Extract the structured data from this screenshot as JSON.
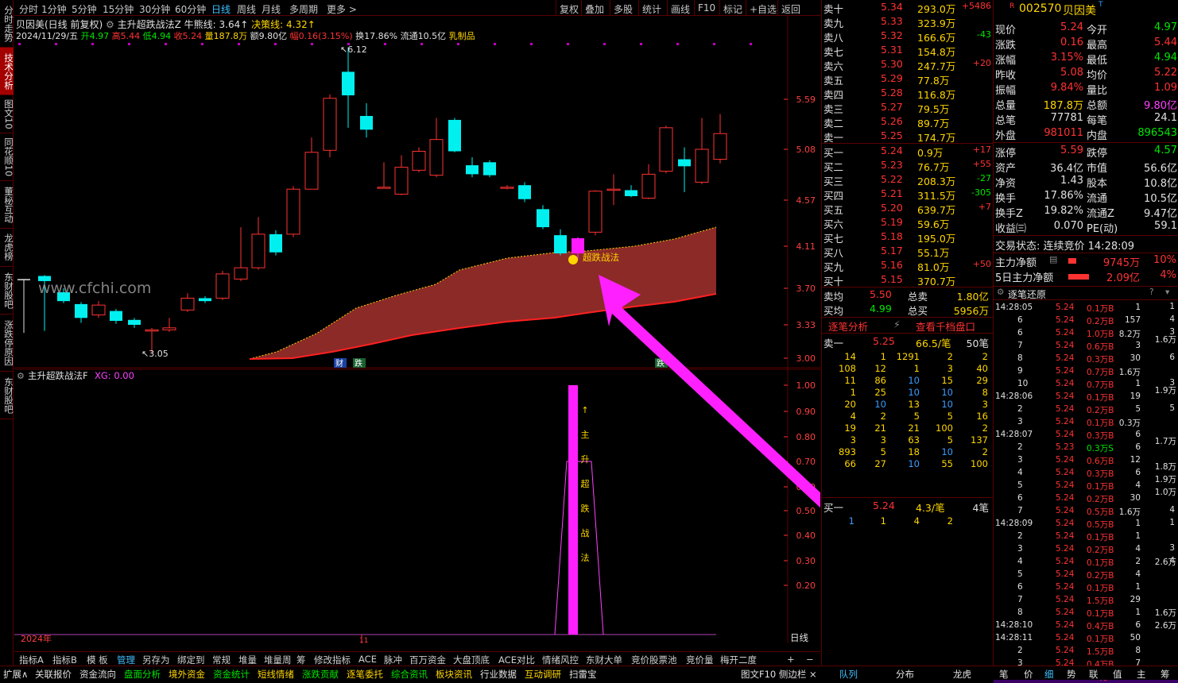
{
  "left_rail": [
    "分时走势",
    "技术分析",
    "图文10",
    "同花顺10",
    "董秘互动",
    "龙虎榜",
    "东财股吧",
    "涨跌停原因",
    "东财股吧"
  ],
  "top_menu": [
    "分时",
    "1分钟",
    "5分钟",
    "15分钟",
    "30分钟",
    "60分钟",
    "日线",
    "周线",
    "月线",
    "多周期",
    "更多 >"
  ],
  "top_right_menu": [
    "复权",
    "叠加",
    "多股",
    "统计",
    "画线",
    "F10",
    "标记",
    "+自选",
    "返回"
  ],
  "header": {
    "stock": "贝因美(日线 前复权)",
    "indicator": "主升超跌战法Z",
    "niuxiong_label": "牛熊线: 3.64↑",
    "juece_label": "决策线: 4.32↑",
    "date": "2024/11/29/五",
    "open": "开4.97",
    "high": "高5.44",
    "low": "低4.94",
    "close": "收5.24",
    "vol": "量187.8万",
    "amt": "额9.80亿",
    "pct": "幅0.16(3.15%)",
    "turn": "换17.86%",
    "float": "流通10.5亿",
    "sector": "乳制品"
  },
  "price_axis": [
    "5.59",
    "5.08",
    "4.57",
    "4.11",
    "3.70",
    "3.33",
    "3.00"
  ],
  "ind_axis": [
    "1.00",
    "0.90",
    "0.80",
    "0.70",
    "0.60",
    "0.50",
    "0.40",
    "0.30",
    "0.20"
  ],
  "annotations": {
    "high": "6.12",
    "low": "3.05",
    "signal": "超跌战法",
    "watermark": "www.cfchi.com",
    "badge1": "财",
    "badge2": "跌",
    "badge3": "跌",
    "year": "2024年",
    "month": "11",
    "period": "日线"
  },
  "sub_indicator": {
    "name": "主升超跌战法F",
    "xg": "XG: 0.00",
    "bar_text": [
      "↑",
      "主",
      "升",
      "超",
      "跌",
      "战",
      "法"
    ]
  },
  "bottom_tabs": [
    "指标A",
    "指标B",
    "模 板",
    "管理",
    "另存为",
    "绑定到",
    "常规",
    "堆量",
    "堆量周",
    "筹",
    "修改指标",
    "ACE",
    "脉冲",
    "百万资金",
    "大盘顶底",
    "ACE对比",
    "情绪风控",
    "东财大单",
    "竞价股票池",
    "竞价量",
    "梅开二度",
    "+",
    "−"
  ],
  "status_bar": [
    "扩展∧",
    "关联报价",
    "资金流向",
    "盘面分析",
    "境外资金",
    "资金统计",
    "短线情绪",
    "涨跌贡献",
    "逐笔委托",
    "综合资讯",
    "板块资讯",
    "行业数据",
    "互动调研",
    "扫雷宝",
    "图文F10 侧边栏 ×",
    "队列",
    "分布",
    "龙虎",
    "笔",
    "价",
    "细",
    "势",
    "联",
    "值",
    "主",
    "筹"
  ],
  "sell_orders": [
    [
      "卖十",
      "5.34",
      "293.0万",
      "+5486"
    ],
    [
      "卖九",
      "5.33",
      "323.9万",
      ""
    ],
    [
      "卖八",
      "5.32",
      "166.6万",
      "-43"
    ],
    [
      "卖七",
      "5.31",
      "154.8万",
      ""
    ],
    [
      "卖六",
      "5.30",
      "247.7万",
      "+20"
    ],
    [
      "卖五",
      "5.29",
      "77.8万",
      ""
    ],
    [
      "卖四",
      "5.28",
      "116.8万",
      ""
    ],
    [
      "卖三",
      "5.27",
      "79.5万",
      ""
    ],
    [
      "卖二",
      "5.26",
      "89.7万",
      ""
    ],
    [
      "卖一",
      "5.25",
      "174.7万",
      ""
    ]
  ],
  "buy_orders": [
    [
      "买一",
      "5.24",
      "0.9万",
      "+17"
    ],
    [
      "买二",
      "5.23",
      "76.7万",
      "+55"
    ],
    [
      "买三",
      "5.22",
      "208.3万",
      "-27"
    ],
    [
      "买四",
      "5.21",
      "311.5万",
      "-305"
    ],
    [
      "买五",
      "5.20",
      "639.7万",
      "+7"
    ],
    [
      "买六",
      "5.19",
      "59.6万",
      ""
    ],
    [
      "买七",
      "5.18",
      "195.0万",
      ""
    ],
    [
      "买八",
      "5.17",
      "55.1万",
      ""
    ],
    [
      "买九",
      "5.16",
      "81.0万",
      "+50"
    ],
    [
      "买十",
      "5.15",
      "370.7万",
      ""
    ]
  ],
  "ob_summary": {
    "sell_avg_l": "卖均",
    "sell_avg": "5.50",
    "sell_total_l": "总卖",
    "sell_total": "1.80亿",
    "buy_avg_l": "买均",
    "buy_avg": "4.99",
    "buy_total_l": "总买",
    "buy_total": "5956万"
  },
  "ob_links": [
    "逐笔分析",
    "查看千档盘口"
  ],
  "queue_sell": {
    "label": "卖一",
    "price": "5.25",
    "vol": "66.5/笔",
    "count": "50笔"
  },
  "queue_sell_rows": [
    [
      "14",
      "1",
      "1291",
      "2",
      "2"
    ],
    [
      "108",
      "12",
      "1",
      "3",
      "40"
    ],
    [
      "11",
      "86",
      "10",
      "15",
      "29"
    ],
    [
      "1",
      "25",
      "10",
      "10",
      "8"
    ],
    [
      "20",
      "10",
      "13",
      "10",
      "3"
    ],
    [
      "4",
      "2",
      "5",
      "5",
      "16"
    ],
    [
      "19",
      "21",
      "21",
      "100",
      "2"
    ],
    [
      "3",
      "3",
      "63",
      "5",
      "137"
    ],
    [
      "893",
      "5",
      "18",
      "10",
      "2"
    ],
    [
      "66",
      "27",
      "10",
      "55",
      "100"
    ]
  ],
  "queue_buy": {
    "label": "买一",
    "price": "5.24",
    "vol": "4.3/笔",
    "count": "4笔",
    "rows": [
      "1",
      "1",
      "4",
      "2"
    ]
  },
  "quote": {
    "code": "002570",
    "name": "贝因美",
    "rows": [
      [
        "现价",
        "5.24",
        "今开",
        "4.97"
      ],
      [
        "涨跌",
        "0.16",
        "最高",
        "5.44"
      ],
      [
        "涨幅",
        "3.15%",
        "最低",
        "4.94"
      ],
      [
        "昨收",
        "5.08",
        "均价",
        "5.22"
      ],
      [
        "振幅",
        "9.84%",
        "量比",
        "1.09"
      ],
      [
        "总量",
        "187.8万",
        "总额",
        "9.80亿"
      ],
      [
        "总笔",
        "77781",
        "每笔",
        "24.1"
      ],
      [
        "外盘",
        "981011",
        "内盘",
        "896543"
      ],
      [
        "涨停",
        "5.59",
        "跌停",
        "4.57"
      ],
      [
        "资产",
        "36.4亿",
        "市值",
        "56.6亿"
      ],
      [
        "净资",
        "1.43",
        "股本",
        "10.8亿"
      ],
      [
        "换手",
        "17.86%",
        "流通",
        "10.5亿"
      ],
      [
        "换手Z",
        "19.82%",
        "流通Z",
        "9.47亿"
      ],
      [
        "收益㈢",
        "0.070",
        "PE(动)",
        "59.1"
      ]
    ],
    "trade_state": "交易状态: 连续竞价 14:28:09",
    "main_flow_l": "主力净额",
    "main_flow": "9745万",
    "main_pct": "10%",
    "flow5_l": "5日主力净额",
    "flow5": "2.09亿",
    "flow5_pct": "4%"
  },
  "tick_title": "逐笔还原",
  "ticks": [
    [
      "14:28:05",
      "5.24",
      "0.1万B",
      "1"
    ],
    [
      "6",
      "5.24",
      "0.2万B",
      "157"
    ],
    [
      "6",
      "5.24",
      "1.0万B",
      "8.2万"
    ],
    [
      "7",
      "5.24",
      "0.6万B",
      "3"
    ],
    [
      "8",
      "5.24",
      "0.3万B",
      "30"
    ],
    [
      "9",
      "5.24",
      "0.7万B",
      "1.6万"
    ],
    [
      "10",
      "5.24",
      "0.7万B",
      "1"
    ],
    [
      "14:28:06",
      "5.24",
      "0.1万B",
      "19"
    ],
    [
      "2",
      "5.24",
      "0.2万B",
      "5"
    ],
    [
      "3",
      "5.24",
      "0.1万B",
      "0.3万"
    ],
    [
      "14:28:07",
      "5.24",
      "0.3万B",
      "6"
    ],
    [
      "2",
      "5.23",
      "0.3万S",
      "6"
    ],
    [
      "3",
      "5.24",
      "0.6万B",
      "12"
    ],
    [
      "4",
      "5.24",
      "0.3万B",
      "6"
    ],
    [
      "5",
      "5.24",
      "0.1万B",
      "4"
    ],
    [
      "6",
      "5.24",
      "0.2万B",
      "30"
    ],
    [
      "7",
      "5.24",
      "0.5万B",
      "1.6万"
    ],
    [
      "14:28:09",
      "5.24",
      "0.5万B",
      "1"
    ],
    [
      "2",
      "5.24",
      "0.1万B",
      "1"
    ],
    [
      "3",
      "5.24",
      "0.2万B",
      "4"
    ],
    [
      "4",
      "5.24",
      "0.1万B",
      "2"
    ],
    [
      "5",
      "5.24",
      "0.2万B",
      "4"
    ],
    [
      "6",
      "5.24",
      "0.1万B",
      "1"
    ],
    [
      "7",
      "5.24",
      "1.5万B",
      "29"
    ],
    [
      "8",
      "5.24",
      "0.1万B",
      "1"
    ],
    [
      "14:28:10",
      "5.24",
      "0.4万B",
      "6"
    ],
    [
      "14:28:11",
      "5.24",
      "0.1万B",
      "50"
    ],
    [
      "2",
      "5.24",
      "1.5万B",
      "8"
    ],
    [
      "3",
      "5.24",
      "0.4万B",
      "7"
    ],
    [
      "14:28:12",
      "5.25",
      "0.5万B",
      "10"
    ]
  ]
}
